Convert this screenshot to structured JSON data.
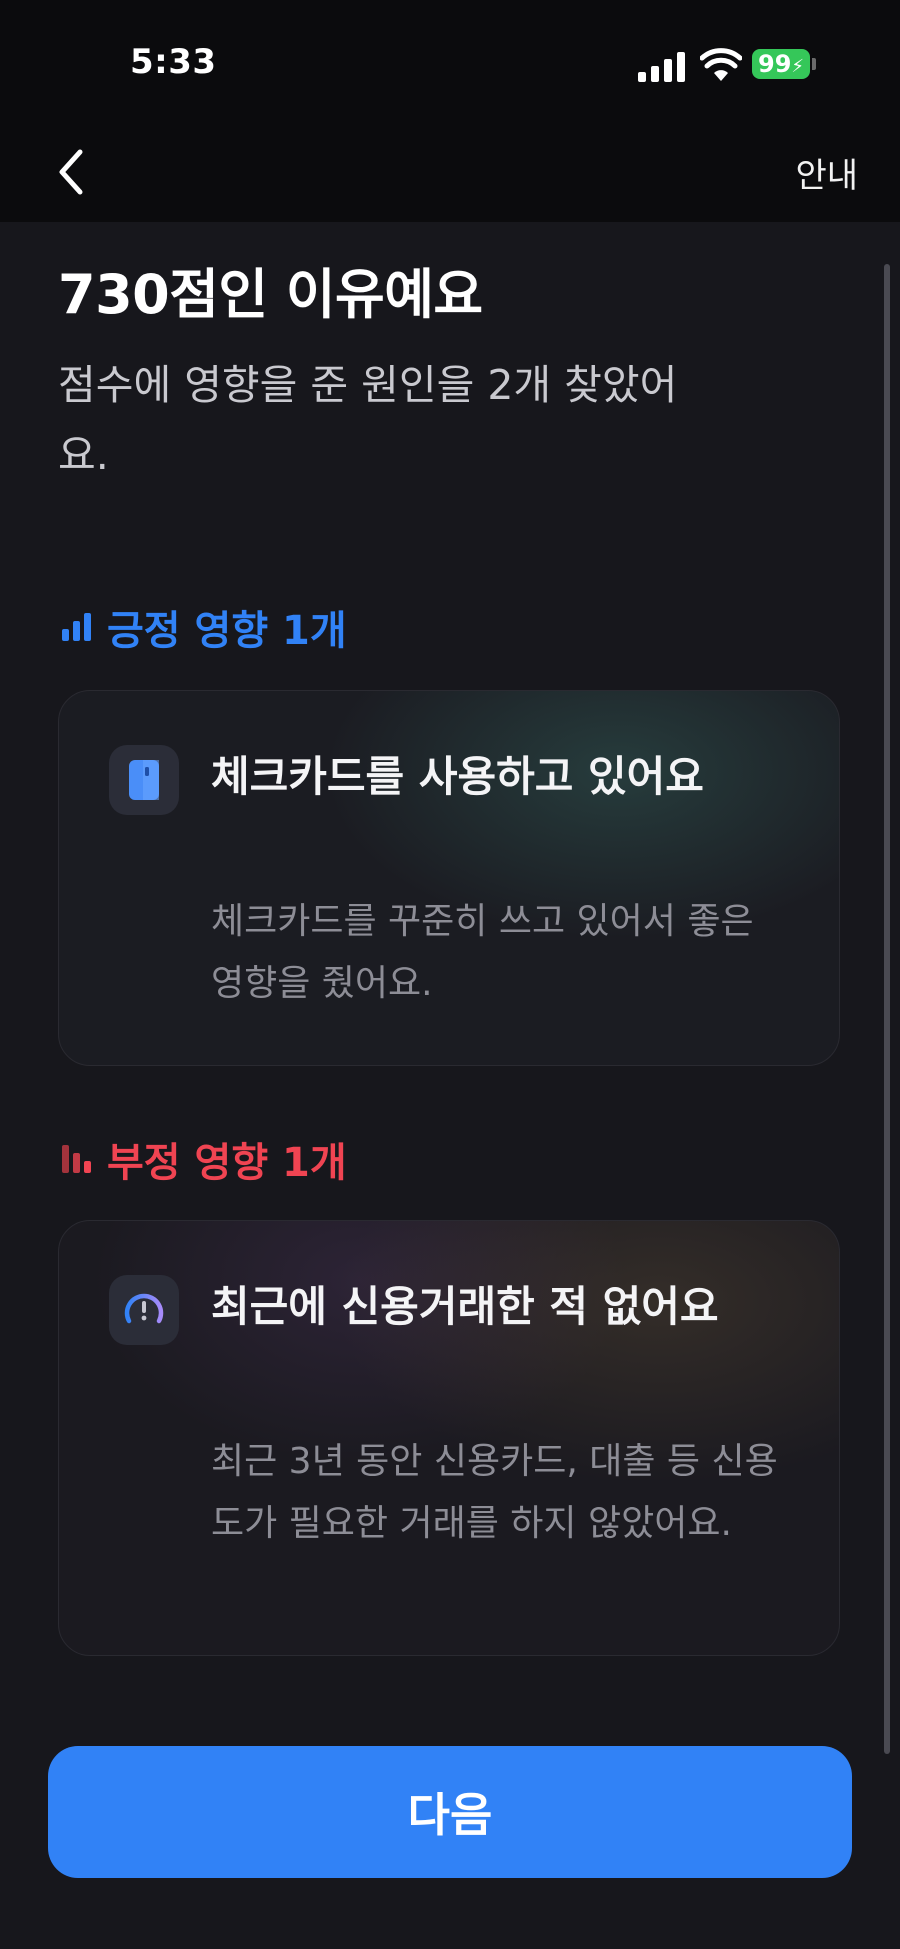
{
  "status_bar": {
    "time": "5:33",
    "battery": "99",
    "battery_color": "#35c759"
  },
  "nav": {
    "back_icon": "chevron-left-icon",
    "guide_label": "안내"
  },
  "header": {
    "title": "730점인 이유예요",
    "subtitle": "점수에 영향을 준 원인을 2개 찾았어요."
  },
  "positive": {
    "heading": "긍정 영향 1개",
    "color": "#3182f6",
    "icon": "bar-chart-icon",
    "card": {
      "icon": "check-card-icon",
      "title": "체크카드를 사용하고 있어요",
      "description": "체크카드를 꾸준히 쓰고 있어서 좋은 영향을 줬어요."
    }
  },
  "negative": {
    "heading": "부정 영향 1개",
    "color": "#f04452",
    "icon": "bar-chart-down-icon",
    "card": {
      "icon": "gauge-warning-icon",
      "title": "최근에 신용거래한 적 없어요",
      "description": "최근 3년 동안 신용카드, 대출 등 신용도가 필요한 거래를 하지 않았어요."
    }
  },
  "footer": {
    "next_label": "다음",
    "accent": "#3182f6"
  }
}
